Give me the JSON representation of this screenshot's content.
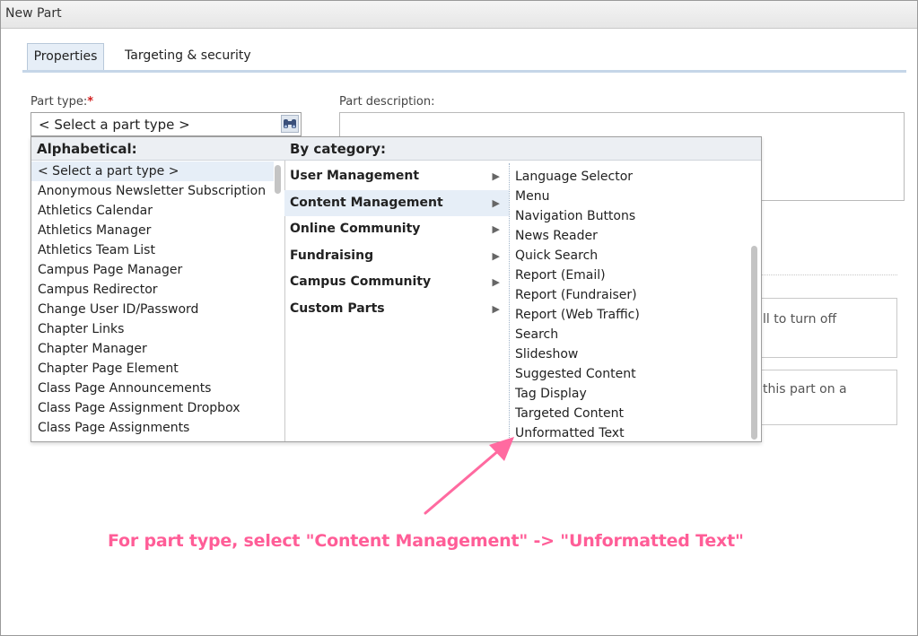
{
  "window": {
    "title": "New Part"
  },
  "tabs": [
    {
      "label": "Properties",
      "active": true
    },
    {
      "label": "Targeting & security",
      "active": false
    }
  ],
  "part_type": {
    "label": "Part type:",
    "required_marker": "*",
    "selected_value": "< Select a part type >",
    "search_icon": "binoculars-icon"
  },
  "part_description": {
    "label": "Part description:",
    "value": ""
  },
  "obscured_text": {
    "line1": "ll to turn off",
    "line2": "this part on a"
  },
  "dropdown": {
    "alpha_header": "Alphabetical:",
    "category_header": "By category:",
    "alphabetical": [
      "< Select a part type >",
      "Anonymous Newsletter Subscription",
      "Athletics Calendar",
      "Athletics Manager",
      "Athletics Team List",
      "Campus Page Manager",
      "Campus Redirector",
      "Change User ID/Password",
      "Chapter Links",
      "Chapter Manager",
      "Chapter Page Element",
      "Class Page Announcements",
      "Class Page Assignment Dropbox",
      "Class Page Assignments"
    ],
    "categories": [
      {
        "label": "User Management",
        "has_submenu": true
      },
      {
        "label": "Content Management",
        "has_submenu": true,
        "selected": true
      },
      {
        "label": "Online Community",
        "has_submenu": true
      },
      {
        "label": "Fundraising",
        "has_submenu": true
      },
      {
        "label": "Campus Community",
        "has_submenu": true
      },
      {
        "label": "Custom Parts",
        "has_submenu": true
      }
    ],
    "content_management_items": [
      "Language Selector",
      "Menu",
      "Navigation Buttons",
      "News Reader",
      "Quick Search",
      "Report (Email)",
      "Report (Fundraiser)",
      "Report (Web Traffic)",
      "Search",
      "Slideshow",
      "Suggested Content",
      "Tag Display",
      "Targeted Content",
      "Unformatted Text"
    ]
  },
  "annotation": {
    "text": "For part type, select \"Content Management\" -> \"Unformatted Text\"",
    "color": "#ff5d97"
  },
  "colors": {
    "selected_bg": "#e6eef7",
    "header_bg": "#eceff3",
    "required": "#d21e1e"
  }
}
